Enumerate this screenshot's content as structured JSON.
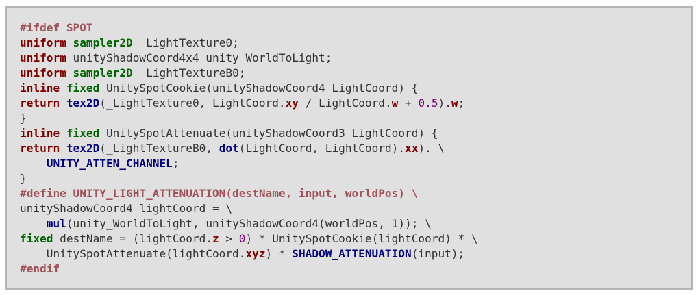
{
  "code_block": {
    "lines": [
      [
        [
          "preproc",
          "#ifdef SPOT"
        ]
      ],
      [
        [
          "keyword",
          "uniform"
        ],
        [
          "plain",
          " "
        ],
        [
          "type",
          "sampler2D"
        ],
        [
          "plain",
          " _LightTexture0;"
        ]
      ],
      [
        [
          "keyword",
          "uniform"
        ],
        [
          "plain",
          " unityShadowCoord4x4 unity_WorldToLight;"
        ]
      ],
      [
        [
          "keyword",
          "uniform"
        ],
        [
          "plain",
          " "
        ],
        [
          "type",
          "sampler2D"
        ],
        [
          "plain",
          " _LightTextureB0;"
        ]
      ],
      [
        [
          "keyword",
          "inline"
        ],
        [
          "plain",
          " "
        ],
        [
          "type",
          "fixed"
        ],
        [
          "plain",
          " UnitySpotCookie(unityShadowCoord4 LightCoord) {"
        ]
      ],
      [
        [
          "keyword",
          "return"
        ],
        [
          "plain",
          " "
        ],
        [
          "func",
          "tex2D"
        ],
        [
          "plain",
          "(_LightTexture0, LightCoord."
        ],
        [
          "member",
          "xy"
        ],
        [
          "plain",
          " / LightCoord."
        ],
        [
          "member",
          "w"
        ],
        [
          "plain",
          " + "
        ],
        [
          "number",
          "0.5"
        ],
        [
          "plain",
          ")."
        ],
        [
          "member",
          "w"
        ],
        [
          "plain",
          ";"
        ]
      ],
      [
        [
          "plain",
          "}"
        ]
      ],
      [
        [
          "keyword",
          "inline"
        ],
        [
          "plain",
          " "
        ],
        [
          "type",
          "fixed"
        ],
        [
          "plain",
          " UnitySpotAttenuate(unityShadowCoord3 LightCoord) {"
        ]
      ],
      [
        [
          "keyword",
          "return"
        ],
        [
          "plain",
          " "
        ],
        [
          "func",
          "tex2D"
        ],
        [
          "plain",
          "(_LightTextureB0, "
        ],
        [
          "func",
          "dot"
        ],
        [
          "plain",
          "(LightCoord, LightCoord)."
        ],
        [
          "member",
          "xx"
        ],
        [
          "plain",
          "). \\"
        ]
      ],
      [
        [
          "plain",
          "    "
        ],
        [
          "macro",
          "UNITY_ATTEN_CHANNEL"
        ],
        [
          "plain",
          ";"
        ]
      ],
      [
        [
          "plain",
          "}"
        ]
      ],
      [
        [
          "preproc",
          "#define UNITY_LIGHT_ATTENUATION(destName, input, worldPos) \\"
        ]
      ],
      [
        [
          "plain",
          "unityShadowCoord4 lightCoord = \\"
        ]
      ],
      [
        [
          "plain",
          "    "
        ],
        [
          "func",
          "mul"
        ],
        [
          "plain",
          "(unity_WorldToLight, unityShadowCoord4(worldPos, "
        ],
        [
          "number",
          "1"
        ],
        [
          "plain",
          ")); \\"
        ]
      ],
      [
        [
          "type",
          "fixed"
        ],
        [
          "plain",
          " destName = (lightCoord."
        ],
        [
          "member",
          "z"
        ],
        [
          "plain",
          " > "
        ],
        [
          "number",
          "0"
        ],
        [
          "plain",
          ") * UnitySpotCookie(lightCoord) * \\"
        ]
      ],
      [
        [
          "plain",
          "    UnitySpotAttenuate(lightCoord."
        ],
        [
          "member",
          "xyz"
        ],
        [
          "plain",
          ") * "
        ],
        [
          "macro",
          "SHADOW_ATTENUATION"
        ],
        [
          "plain",
          "(input);"
        ]
      ],
      [
        [
          "preproc",
          "#endif"
        ]
      ]
    ]
  }
}
